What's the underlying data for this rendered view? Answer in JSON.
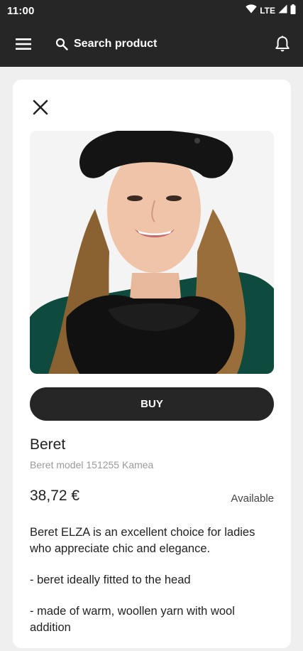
{
  "status_bar": {
    "time": "11:00",
    "network": "LTE"
  },
  "app_bar": {
    "menu_icon": "hamburger-menu-icon",
    "search_icon": "search-icon",
    "search_label": "Search product",
    "notification_icon": "bell-icon",
    "background_color": "#262626"
  },
  "product": {
    "close_icon": "close-icon",
    "image_alt": "Woman wearing black beret and scarf",
    "buy_label": "BUY",
    "name": "Beret",
    "subtitle": "Beret model 151255 Kamea",
    "price": "38,72 €",
    "availability": "Available",
    "description": [
      "Beret ELZA is an excellent choice for ladies who appreciate chic and elegance.",
      "- beret ideally fitted to the head",
      "- made of warm, woollen yarn with wool addition"
    ]
  }
}
